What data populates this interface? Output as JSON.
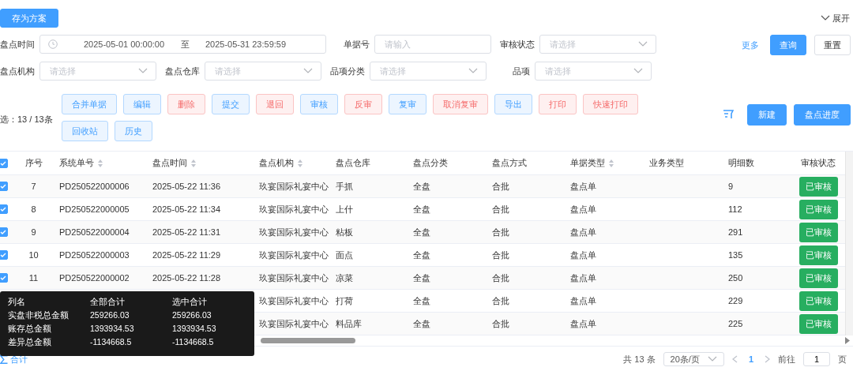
{
  "toolbar": {
    "save_plan_button": "存为方案",
    "expand_toggle": {
      "label": "展开",
      "expanded": false
    }
  },
  "filters": [
    [
      {
        "kind": "daterange",
        "label": "盘点时间",
        "start": "2025-05-01 00:00:00",
        "separator": "至",
        "end": "2025-05-31 23:59:59"
      },
      {
        "kind": "input",
        "label": "单据号",
        "placeholder": "请输入"
      },
      {
        "kind": "select",
        "label": "审核状态",
        "placeholder": "请选择"
      }
    ],
    [
      {
        "kind": "select",
        "label": "盘点机构",
        "placeholder": "请选择"
      },
      {
        "kind": "select",
        "label": "盘点仓库",
        "placeholder": "请选择"
      },
      {
        "kind": "select",
        "label": "品项分类",
        "placeholder": "请选择"
      },
      {
        "kind": "select",
        "label": "品项",
        "placeholder": "请选择"
      }
    ]
  ],
  "filter_actions": {
    "more_link": "更多",
    "query_button": "查询",
    "reset_button": "重置"
  },
  "selection_summary": "选：13 / 13条",
  "action_buttons": [
    {
      "label": "合并单据",
      "kind": "info"
    },
    {
      "label": "编辑",
      "kind": "info"
    },
    {
      "label": "删除",
      "kind": "danger"
    },
    {
      "label": "提交",
      "kind": "info"
    },
    {
      "label": "退回",
      "kind": "danger"
    },
    {
      "label": "审核",
      "kind": "info"
    },
    {
      "label": "反审",
      "kind": "danger"
    },
    {
      "label": "复审",
      "kind": "info"
    },
    {
      "label": "取消复审",
      "kind": "danger"
    },
    {
      "label": "导出",
      "kind": "info"
    },
    {
      "label": "打印",
      "kind": "danger"
    },
    {
      "label": "快速打印",
      "kind": "danger"
    },
    {
      "label": "回收站",
      "kind": "info"
    },
    {
      "label": "历史",
      "kind": "info"
    }
  ],
  "primary_buttons": [
    "新建",
    "盘点进度"
  ],
  "table": {
    "all_selected": true,
    "columns": [
      {
        "label": "序号",
        "sortable": false
      },
      {
        "label": "系统单号",
        "sortable": true
      },
      {
        "label": "盘点时间",
        "sortable": true
      },
      {
        "label": "盘点机构",
        "sortable": true
      },
      {
        "label": "盘点仓库",
        "sortable": false
      },
      {
        "label": "盘点分类",
        "sortable": false
      },
      {
        "label": "盘点方式",
        "sortable": false
      },
      {
        "label": "单据类型",
        "sortable": true
      },
      {
        "label": "业务类型",
        "sortable": false
      },
      {
        "label": "明细数",
        "sortable": false
      },
      {
        "label": "审核状态",
        "sortable": false
      }
    ],
    "rows": [
      {
        "selected": true,
        "cells": [
          "7",
          "PD250522000006",
          "2025-05-22 11:36",
          "玖宴国际礼宴中心",
          "手抓",
          "全盘",
          "合批",
          "盘点单",
          "",
          "9"
        ],
        "status": "已审核"
      },
      {
        "selected": true,
        "cells": [
          "8",
          "PD250522000005",
          "2025-05-22 11:34",
          "玖宴国际礼宴中心",
          "上什",
          "全盘",
          "合批",
          "盘点单",
          "",
          "112"
        ],
        "status": "已审核"
      },
      {
        "selected": true,
        "cells": [
          "9",
          "PD250522000004",
          "2025-05-22 11:31",
          "玖宴国际礼宴中心",
          "粘板",
          "全盘",
          "合批",
          "盘点单",
          "",
          "291"
        ],
        "status": "已审核"
      },
      {
        "selected": true,
        "cells": [
          "10",
          "PD250522000003",
          "2025-05-22 11:29",
          "玖宴国际礼宴中心",
          "面点",
          "全盘",
          "合批",
          "盘点单",
          "",
          "135"
        ],
        "status": "已审核"
      },
      {
        "selected": true,
        "cells": [
          "11",
          "PD250522000002",
          "2025-05-22 11:28",
          "玖宴国际礼宴中心",
          "凉菜",
          "全盘",
          "合批",
          "盘点单",
          "",
          "250"
        ],
        "status": "已审核"
      },
      {
        "cells": [
          "",
          "",
          "",
          "玖宴国际礼宴中心",
          "打荷",
          "全盘",
          "合批",
          "盘点单",
          "",
          "229"
        ],
        "status": "已审核"
      },
      {
        "cells": [
          "",
          "",
          "",
          "玖宴国际礼宴中心",
          "料品库",
          "全盘",
          "合批",
          "盘点单",
          "",
          "225"
        ],
        "status": "已审核"
      }
    ]
  },
  "totals_tooltip": {
    "columns": [
      "列名",
      "全部合计",
      "选中合计"
    ],
    "rows": [
      [
        "实盘非税总金额",
        "259266.03",
        "259266.03"
      ],
      [
        "账存总金额",
        "1393934.53",
        "1393934.53"
      ],
      [
        "差异总金额",
        "-1134668.5",
        "-1134668.5"
      ]
    ]
  },
  "footer": {
    "total_label": "合计",
    "count": "共 13 条",
    "page_size": "20条/页",
    "pages": [
      {
        "label": "1",
        "selected": true
      }
    ],
    "goto_label": "前往",
    "goto_value": "1",
    "page_unit": "页"
  }
}
